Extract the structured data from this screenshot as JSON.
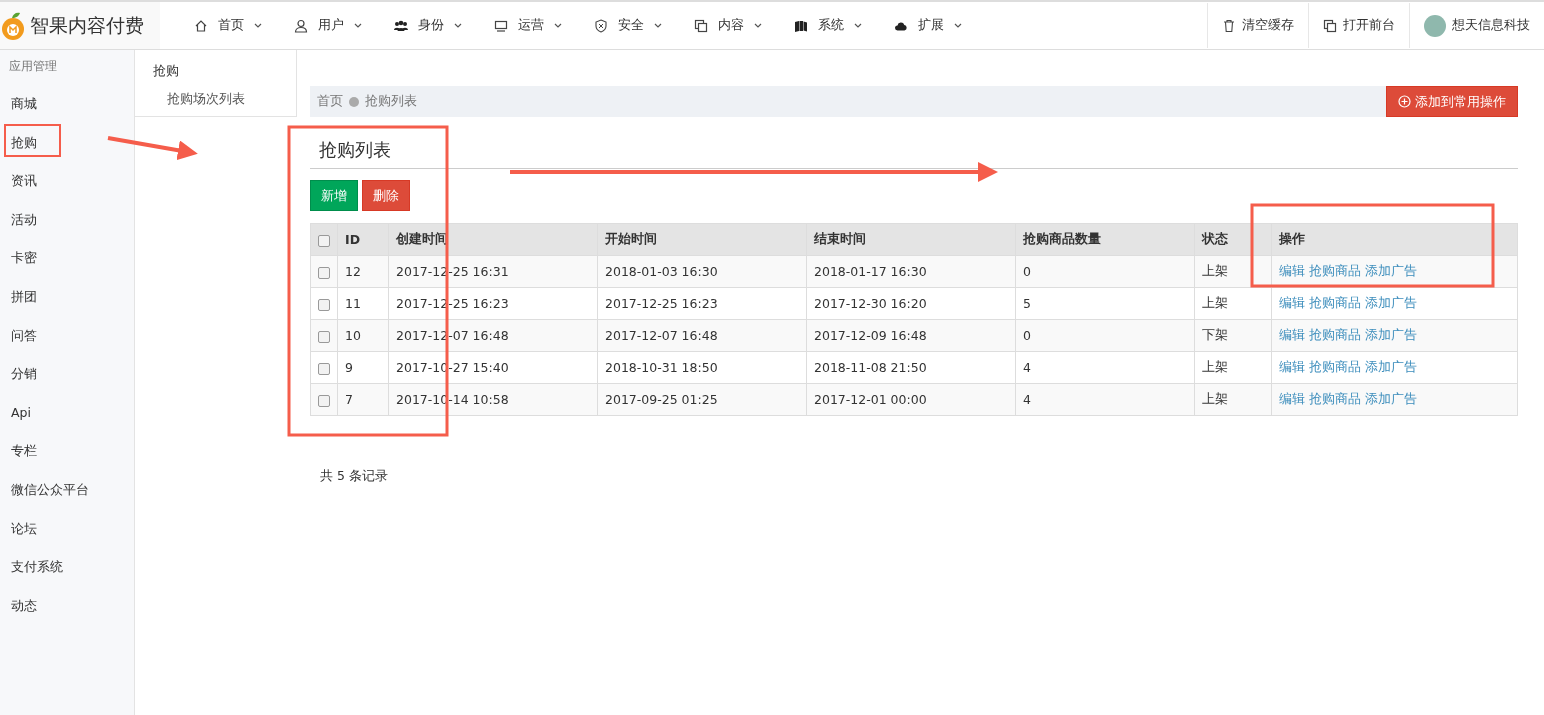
{
  "brand": {
    "name": "智果内容付费"
  },
  "nav": [
    {
      "label": "首页"
    },
    {
      "label": "用户"
    },
    {
      "label": "身份"
    },
    {
      "label": "运营"
    },
    {
      "label": "安全"
    },
    {
      "label": "内容"
    },
    {
      "label": "系统"
    },
    {
      "label": "扩展"
    }
  ],
  "top_actions": [
    {
      "label": "清空缓存"
    },
    {
      "label": "打开前台"
    }
  ],
  "user": {
    "name": "想天信息科技"
  },
  "sidebar": {
    "heading": "应用管理",
    "items": [
      "商城",
      "抢购",
      "资讯",
      "活动",
      "卡密",
      "拼团",
      "问答",
      "分销",
      "Api",
      "专栏",
      "微信公众平台",
      "论坛",
      "支付系统",
      "动态"
    ]
  },
  "subnav": {
    "title": "抢购",
    "items": [
      "抢购场次列表"
    ]
  },
  "breadcrumb": [
    "首页",
    "抢购列表"
  ],
  "add_shortcut_button": "添加到常用操作",
  "page_title": "抢购列表",
  "toolbar": [
    {
      "label": "新增",
      "kind": "primary"
    },
    {
      "label": "删除",
      "kind": "danger"
    }
  ],
  "table": {
    "header_checked": false,
    "columns": [
      "ID",
      "创建时间",
      "开始时间",
      "结束时间",
      "抢购商品数量",
      "状态",
      "操作"
    ],
    "rows": [
      {
        "checked": false,
        "cells": [
          "12",
          "2017-12-25 16:31",
          "2018-01-03 16:30",
          "2018-01-17 16:30",
          "0",
          "上架"
        ],
        "actions": [
          "编辑",
          "抢购商品",
          "添加广告"
        ]
      },
      {
        "checked": false,
        "cells": [
          "11",
          "2017-12-25 16:23",
          "2017-12-25 16:23",
          "2017-12-30 16:20",
          "5",
          "上架"
        ],
        "actions": [
          "编辑",
          "抢购商品",
          "添加广告"
        ]
      },
      {
        "checked": false,
        "cells": [
          "10",
          "2017-12-07 16:48",
          "2017-12-07 16:48",
          "2017-12-09 16:48",
          "0",
          "下架"
        ],
        "actions": [
          "编辑",
          "抢购商品",
          "添加广告"
        ]
      },
      {
        "checked": false,
        "cells": [
          "9",
          "2017-10-27 15:40",
          "2018-10-31 18:50",
          "2018-11-08 21:50",
          "4",
          "上架"
        ],
        "actions": [
          "编辑",
          "抢购商品",
          "添加广告"
        ]
      },
      {
        "checked": false,
        "cells": [
          "7",
          "2017-10-14 10:58",
          "2017-09-25 01:25",
          "2017-12-01 00:00",
          "4",
          "上架"
        ],
        "actions": [
          "编辑",
          "抢购商品",
          "添加广告"
        ]
      }
    ]
  },
  "record_count": "共 5 条记录"
}
